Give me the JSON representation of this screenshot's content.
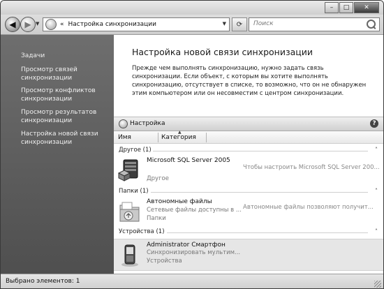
{
  "window": {
    "buttons": {
      "minimize": "–",
      "maximize": "□",
      "close": "✕"
    }
  },
  "address": {
    "breadcrumb_chevron": "«",
    "path": "Настройка синхронизации",
    "search_placeholder": "Поиск"
  },
  "sidebar": {
    "items": [
      {
        "label": "Задачи"
      },
      {
        "label": "Просмотр связей синхронизации"
      },
      {
        "label": "Просмотр конфликтов синхронизации"
      },
      {
        "label": "Просмотр результатов синхронизации"
      },
      {
        "label": "Настройка новой связи синхронизации"
      }
    ]
  },
  "main": {
    "title": "Настройка новой связи синхронизации",
    "description": "Прежде чем выполнять синхронизацию, нужно задать связь синхронизации. Если объект, с которым вы хотите выполнять синхронизацию, отсутствует в списке, то возможно, что он не обнаружен этим компьютером или он несовместим с центром синхронизации.",
    "section_label": "Настройка",
    "help_glyph": "?",
    "columns": {
      "name": "Имя",
      "category": "Категория"
    },
    "groups": [
      {
        "label": "Другое (1)",
        "chevron": "˄",
        "items": [
          {
            "name": "Microsoft SQL Server 2005",
            "subtitle": "",
            "category": "Другое",
            "description": "Чтобы настроить Microsoft SQL Server 200..."
          }
        ]
      },
      {
        "label": "Папки (1)",
        "chevron": "˄",
        "items": [
          {
            "name": "Автономные файлы",
            "subtitle": "Сетевые файлы доступны в ...",
            "category": "Папки",
            "description": "Автономные файлы позволяют получит..."
          }
        ]
      },
      {
        "label": "Устройства (1)",
        "chevron": "˄",
        "items": [
          {
            "name": "Administrator Смартфон",
            "subtitle": "Синхронизировать мультим...",
            "category": "Устройства",
            "description": ""
          }
        ]
      }
    ]
  },
  "status": {
    "text": "Выбрано элементов: 1"
  },
  "colors": {
    "sidebar": "#5c5c5c",
    "selected_row": "#e6e6e6"
  }
}
